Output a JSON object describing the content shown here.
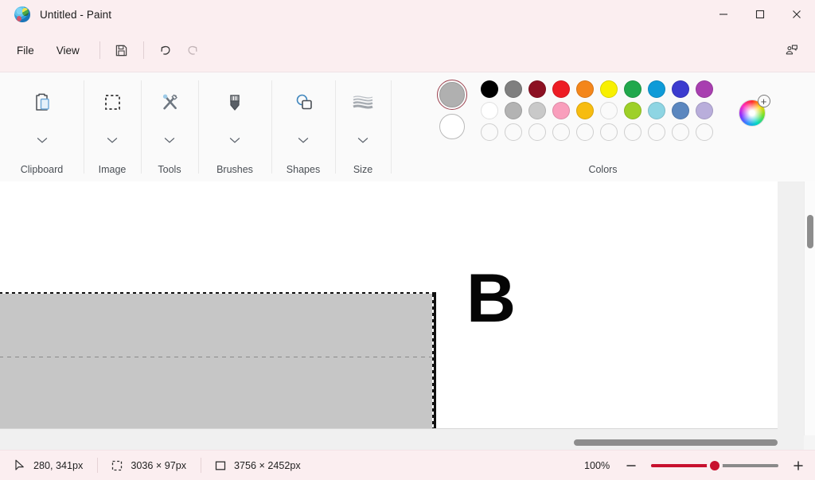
{
  "window": {
    "title": "Untitled - Paint",
    "app_icon": "paint-palette-icon",
    "minimize_label": "–",
    "maximize_label": "□",
    "close_label": "✕"
  },
  "menubar": {
    "items": [
      {
        "label": "File",
        "name": "menu-file"
      },
      {
        "label": "View",
        "name": "menu-view"
      }
    ],
    "save_icon": "save-icon",
    "undo_icon": "undo-icon",
    "redo_icon": "redo-icon",
    "copilot_icon": "copilot-icon"
  },
  "ribbon": {
    "groups": [
      {
        "label": "Clipboard",
        "icon": "clipboard-icon"
      },
      {
        "label": "Image",
        "icon": "select-rectangle-icon"
      },
      {
        "label": "Tools",
        "icon": "pencil-brush-icon"
      },
      {
        "label": "Brushes",
        "icon": "brush-icon"
      },
      {
        "label": "Shapes",
        "icon": "shapes-icon"
      },
      {
        "label": "Size",
        "icon": "size-lines-icon"
      }
    ],
    "colors": {
      "label": "Colors",
      "primary": "#b0b0b0",
      "secondary": "#ffffff",
      "selection_ring": "#9d4350",
      "row1": [
        "#000000",
        "#7f7f7f",
        "#8c1022",
        "#ed1c24",
        "#f4861a",
        "#f8f000",
        "#21a84c",
        "#0e9bd8",
        "#3b3bcf",
        "#a83fb0"
      ],
      "row2": [
        "#ffffff",
        "#b3b3b3",
        "#c9c9c9",
        "#f99ebc",
        "#f7bc10",
        "#e8dcа2",
        "#9ed028",
        "#8ed5e3",
        "#5b87bf",
        "#b9aedb"
      ],
      "row3_empty_count": 10,
      "wheel_icon": "color-wheel-add-icon"
    }
  },
  "canvas": {
    "letter": "B",
    "selection_fill": "#c6c6c6",
    "page_background": "#ffffff"
  },
  "statusbar": {
    "cursor_icon": "cursor-arrow-icon",
    "cursor_position": "280, 341px",
    "selection_icon": "selection-size-icon",
    "selection_size": "3036 × 97px",
    "image_icon": "image-size-icon",
    "image_size": "3756 × 2452px",
    "zoom_level": "100%",
    "zoom_out_label": "−",
    "zoom_in_label": "+",
    "slider_accent": "#c8102e"
  }
}
